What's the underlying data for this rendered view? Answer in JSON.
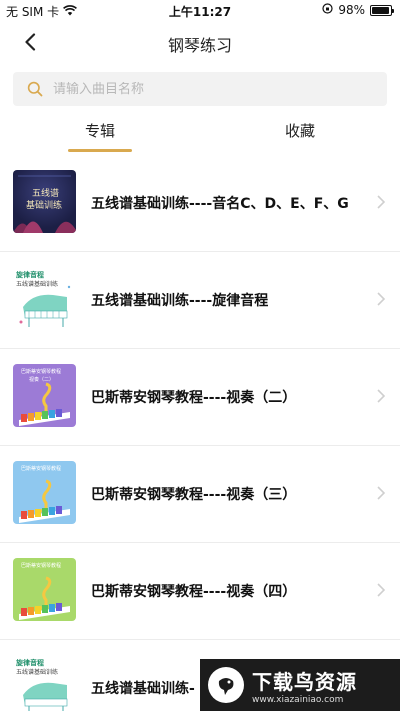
{
  "status_bar": {
    "carrier": "无 SIM 卡",
    "time": "上午11:27",
    "battery": "98%"
  },
  "header": {
    "title": "钢琴练习"
  },
  "search": {
    "placeholder": "请输入曲目名称"
  },
  "tabs": [
    {
      "label": "专辑",
      "active": true
    },
    {
      "label": "收藏",
      "active": false
    }
  ],
  "albums": [
    {
      "title": "五线谱基础训练----音名C、D、E、F、G",
      "thumb_style": "dark",
      "thumb_text": [
        "五线谱",
        "基础训练"
      ]
    },
    {
      "title": "五线谱基础训练----旋律音程",
      "thumb_style": "piano",
      "thumb_text": [
        "旋律音程",
        "五线谱基础训练"
      ]
    },
    {
      "title": "巴斯蒂安钢琴教程----视奏（二）",
      "thumb_style": "purple",
      "thumb_text": [
        "巴斯蒂安钢琴教程",
        "视奏（二）"
      ]
    },
    {
      "title": "巴斯蒂安钢琴教程----视奏（三）",
      "thumb_style": "blue",
      "thumb_text": [
        "巴斯蒂安钢琴教程"
      ]
    },
    {
      "title": "巴斯蒂安钢琴教程----视奏（四）",
      "thumb_style": "green",
      "thumb_text": [
        "巴斯蒂安钢琴教程"
      ]
    },
    {
      "title": "五线谱基础训练-",
      "thumb_style": "piano",
      "thumb_text": [
        "旋律音程",
        "五线谱基础训练"
      ]
    }
  ],
  "watermark": {
    "main": "下载鸟资源",
    "sub": "www.xiazainiao.com"
  },
  "colors": {
    "accent": "#d9a94f",
    "search_bg": "#f2f2f2"
  }
}
